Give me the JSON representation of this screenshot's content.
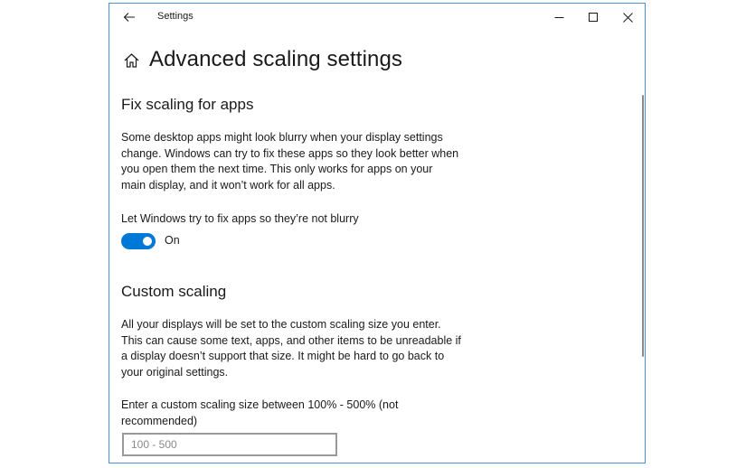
{
  "window": {
    "title": "Settings"
  },
  "icons": {
    "back": "back-arrow-icon",
    "home": "home-icon",
    "minimize": "minimize-icon",
    "maximize": "maximize-icon",
    "close": "close-icon"
  },
  "page": {
    "title": "Advanced scaling settings"
  },
  "fix_scaling": {
    "heading": "Fix scaling for apps",
    "description_lines": [
      "Some desktop apps might look blurry when your display settings",
      "change. Windows can try to fix these apps so they look better when",
      "you open them the next time. This only works for apps on your",
      "main display, and it won’t work for all apps."
    ],
    "toggle_label": "Let Windows try to fix apps so they’re not blurry",
    "toggle_state": "On",
    "toggle_on": true
  },
  "custom_scaling": {
    "heading": "Custom scaling",
    "description_lines": [
      "All your displays will be set to the custom scaling size you enter.",
      "This can cause some text, apps, and other items to be unreadable if",
      "a display doesn’t support that size. It might be hard to go back to",
      "your original settings."
    ],
    "input_label_lines": [
      "Enter a custom scaling size between 100% - 500% (not",
      "recommended)"
    ],
    "input_value": "",
    "input_placeholder": "100 - 500"
  },
  "colors": {
    "accent": "#0078d7",
    "window_border": "#4a90d9",
    "text": "#1a1a1a",
    "input_border": "#999999"
  }
}
